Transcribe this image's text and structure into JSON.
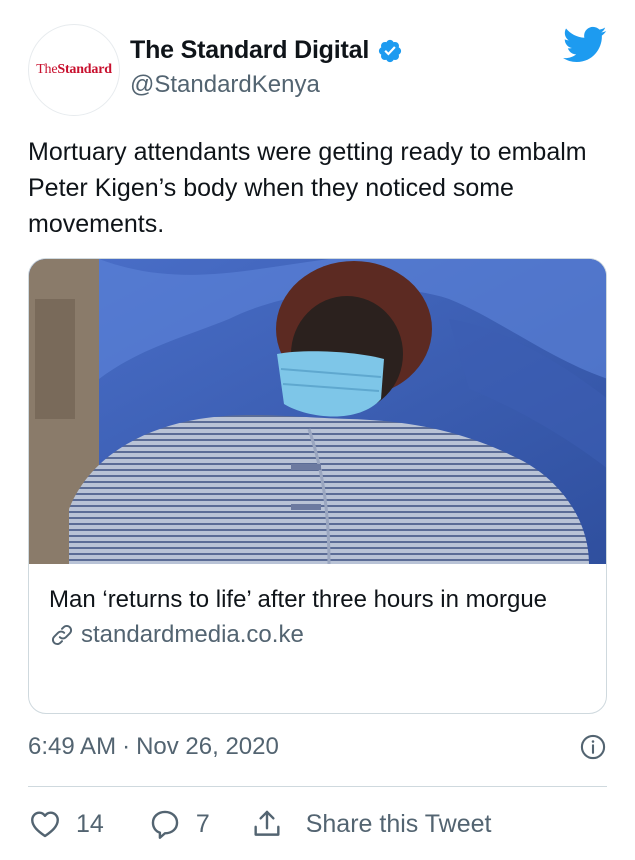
{
  "account": {
    "display_name": "The Standard Digital",
    "handle": "@StandardKenya",
    "verified": true,
    "avatar_logo_prefix": "The",
    "avatar_logo_main": "Standard"
  },
  "tweet": {
    "text": "Mortuary attendants were getting ready to embalm Peter Kigen’s body when they noticed some movements."
  },
  "card": {
    "title": "Man ‘returns to life’ after three hours in morgue",
    "domain": "standardmedia.co.ke"
  },
  "meta": {
    "time": "6:49 AM",
    "separator": "·",
    "date": "Nov 26, 2020"
  },
  "actions": {
    "likes": "14",
    "replies": "7",
    "share_label": "Share this Tweet"
  },
  "colors": {
    "twitter_blue": "#1d9bf0",
    "secondary_text": "#536471",
    "brand_red": "#c8102e"
  },
  "icons": {
    "brand": "twitter-bird-icon",
    "verified": "verified-badge-icon",
    "link": "link-icon",
    "info": "info-icon",
    "like": "heart-icon",
    "reply": "reply-bubble-icon",
    "share": "share-icon"
  }
}
